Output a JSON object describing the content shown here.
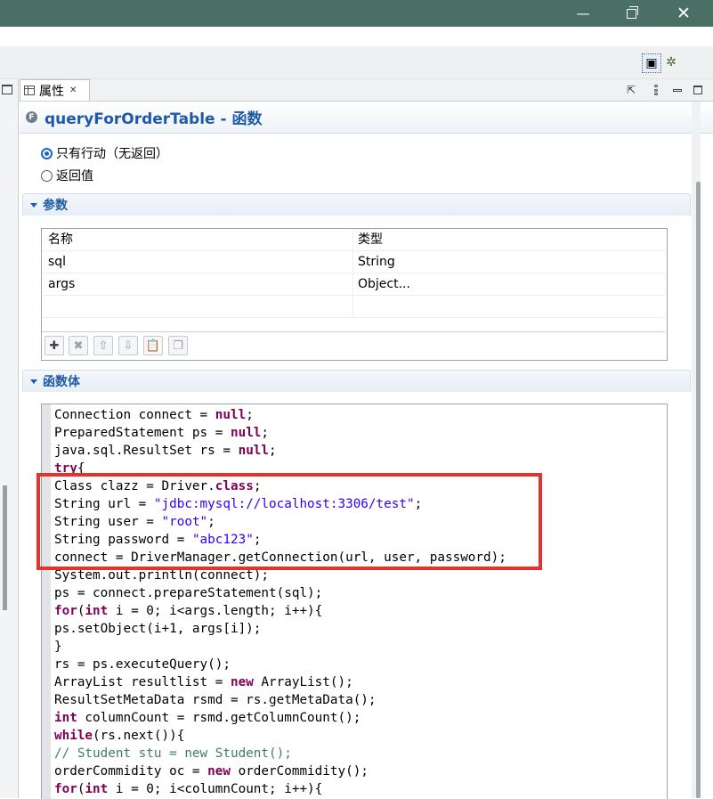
{
  "window": {
    "minimize_label": "—",
    "close_label": "✕"
  },
  "toolbar": {
    "perspective_icon": "java-perspective-icon",
    "debug_icon": "debug-perspective-icon"
  },
  "view": {
    "tab_label": "属性",
    "tab_close": "✕",
    "header_title": "queryForOrderTable - 函数",
    "header_badge": "F"
  },
  "return_options": {
    "option1": "只有行动（无返回）",
    "option2": "返回值",
    "selected": "option1"
  },
  "params_section": {
    "title": "参数",
    "columns": [
      "名称",
      "类型"
    ],
    "rows": [
      {
        "name": "sql",
        "type": "String"
      },
      {
        "name": "args",
        "type": "Object..."
      },
      {
        "name": "",
        "type": ""
      }
    ],
    "buttons": [
      "add-icon",
      "remove-icon",
      "move-up-icon",
      "move-down-icon",
      "paste-icon",
      "copy-icon"
    ]
  },
  "body_section": {
    "title": "函数体"
  },
  "code": [
    [
      {
        "t": "Connection connect = "
      },
      {
        "t": "null",
        "c": "kw"
      },
      {
        "t": ";"
      }
    ],
    [
      {
        "t": "PreparedStatement ps = "
      },
      {
        "t": "null",
        "c": "kw"
      },
      {
        "t": ";"
      }
    ],
    [
      {
        "t": "java.sql.ResultSet rs = "
      },
      {
        "t": "null",
        "c": "kw"
      },
      {
        "t": ";"
      }
    ],
    [
      {
        "t": "try",
        "c": "kw"
      },
      {
        "t": "{"
      }
    ],
    [
      {
        "t": "Class clazz = Driver."
      },
      {
        "t": "class",
        "c": "kw"
      },
      {
        "t": ";"
      }
    ],
    [
      {
        "t": "String url = "
      },
      {
        "t": "\"jdbc:mysql://localhost:3306/test\"",
        "c": "str"
      },
      {
        "t": ";"
      }
    ],
    [
      {
        "t": "String user = "
      },
      {
        "t": "\"root\"",
        "c": "str"
      },
      {
        "t": ";"
      }
    ],
    [
      {
        "t": "String password = "
      },
      {
        "t": "\"abc123\"",
        "c": "str"
      },
      {
        "t": ";"
      }
    ],
    [
      {
        "t": "connect = DriverManager.getConnection(url, user, password);"
      }
    ],
    [
      {
        "t": "System.out.println(connect);"
      }
    ],
    [
      {
        "t": "ps = connect.prepareStatement(sql);"
      }
    ],
    [
      {
        "t": "for",
        "c": "kw"
      },
      {
        "t": "("
      },
      {
        "t": "int",
        "c": "kw"
      },
      {
        "t": " i = 0; i<args.length; i++){"
      }
    ],
    [
      {
        "t": "ps.setObject(i+1, args[i]);"
      }
    ],
    [
      {
        "t": "}"
      }
    ],
    [
      {
        "t": "rs = ps.executeQuery();"
      }
    ],
    [
      {
        "t": "ArrayList resultlist = "
      },
      {
        "t": "new",
        "c": "kw"
      },
      {
        "t": " ArrayList();"
      }
    ],
    [
      {
        "t": "ResultSetMetaData rsmd = rs.getMetaData();"
      }
    ],
    [
      {
        "t": "int",
        "c": "kw"
      },
      {
        "t": " columnCount = rsmd.getColumnCount();"
      }
    ],
    [
      {
        "t": "while",
        "c": "kw"
      },
      {
        "t": "(rs.next()){"
      }
    ],
    [
      {
        "t": "// Student stu = new Student();",
        "c": "cmt"
      }
    ],
    [
      {
        "t": "orderCommidity oc = "
      },
      {
        "t": "new",
        "c": "kw"
      },
      {
        "t": " orderCommidity();"
      }
    ],
    [
      {
        "t": "for",
        "c": "kw"
      },
      {
        "t": "("
      },
      {
        "t": "int",
        "c": "kw"
      },
      {
        "t": " i = 0; i<columnCount; i++){"
      }
    ]
  ]
}
